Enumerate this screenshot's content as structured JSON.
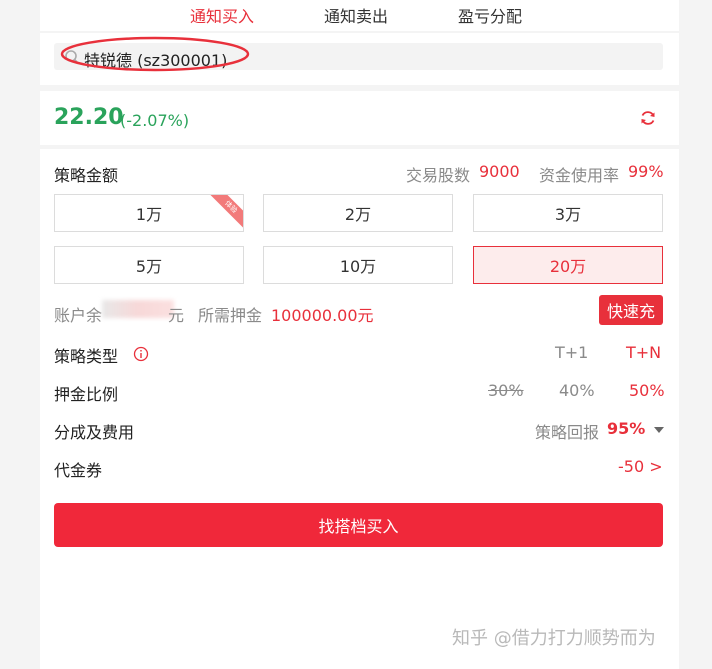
{
  "tabs": [
    {
      "label": "通知买入",
      "active": true
    },
    {
      "label": "通知卖出",
      "active": false
    },
    {
      "label": "盈亏分配",
      "active": false
    }
  ],
  "search": {
    "value": "特锐德 (sz300001)"
  },
  "quote": {
    "price": "22.20",
    "change": "(-2.07%)"
  },
  "strategy_amount": {
    "label": "策略金额",
    "shares_label": "交易股数",
    "shares_value": "9000",
    "usage_label": "资金使用率",
    "usage_value": "99%",
    "options": [
      "1万",
      "2万",
      "3万",
      "5万",
      "10万",
      "20万"
    ],
    "selected": "20万",
    "ribbon": "体验"
  },
  "balance": {
    "prefix": "账户余",
    "suffix": "元",
    "deposit_label": "所需押金",
    "deposit_value": "100000.00元",
    "recharge_label": "快速充"
  },
  "strategy_type": {
    "label": "策略类型",
    "options": [
      "T+1",
      "T+N"
    ],
    "selected": "T+N"
  },
  "deposit_ratio": {
    "label": "押金比例",
    "options": [
      "30%",
      "40%",
      "50%"
    ],
    "selected": "50%",
    "disabled": "30%"
  },
  "fees": {
    "label": "分成及费用",
    "rebate_label": "策略回报",
    "rebate_value": "95%"
  },
  "coupon": {
    "label": "代金券",
    "value": "-50 >"
  },
  "buy_button": "找搭档买入",
  "watermark": "知乎 @借力打力顺势而为",
  "colors": {
    "accent": "#e8303b",
    "price_down": "#2aa35b"
  }
}
